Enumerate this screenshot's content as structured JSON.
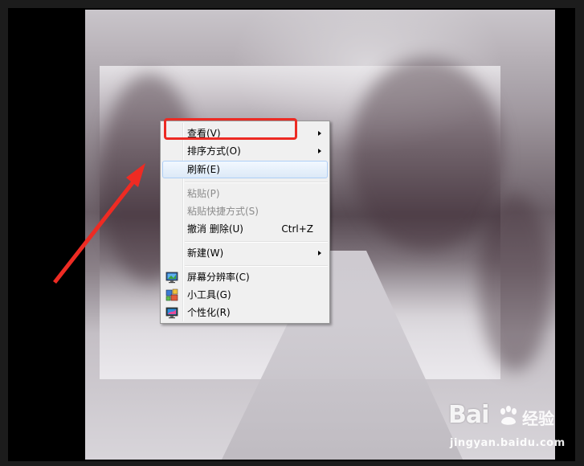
{
  "menu": {
    "items": [
      {
        "label": "查看(V)",
        "submenu": true
      },
      {
        "label": "排序方式(O)",
        "submenu": true
      },
      {
        "label": "刷新(E)",
        "state": "hover"
      },
      {
        "label": "粘贴(P)",
        "state": "disabled"
      },
      {
        "label": "粘贴快捷方式(S)",
        "state": "disabled"
      },
      {
        "label": "撤消 删除(U)",
        "shortcut": "Ctrl+Z"
      },
      {
        "label": "新建(W)",
        "submenu": true
      },
      {
        "label": "屏幕分辨率(C)",
        "icon": "screen-resolution-icon"
      },
      {
        "label": "小工具(G)",
        "icon": "gadgets-icon"
      },
      {
        "label": "个性化(R)",
        "icon": "personalize-icon"
      }
    ]
  },
  "annotation": {
    "highlight_color": "#ec2b24"
  },
  "watermark": {
    "brand": "Bai",
    "brand_suffix": "经验",
    "url": "jingyan.baidu.com"
  }
}
